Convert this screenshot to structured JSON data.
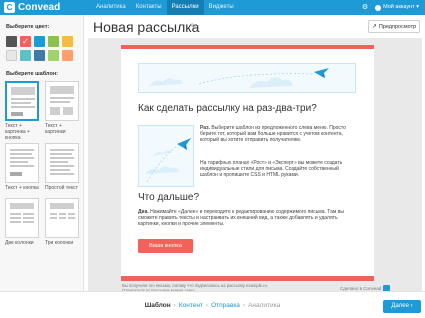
{
  "header": {
    "logo_mark": "C",
    "logo_text": "Convead",
    "nav": [
      {
        "label": "Аналитика"
      },
      {
        "label": "Контакты"
      },
      {
        "label": "Рассылки"
      },
      {
        "label": "Виджеты"
      }
    ],
    "nav_active_index": 2,
    "account_label": "Мой аккаунт ▾",
    "gear": "⚙"
  },
  "sidebar": {
    "color_title": "Выберите цвет:",
    "colors": [
      "#555555",
      "#f2625a",
      "#1e9ad6",
      "#8cc152",
      "#f6bb42",
      "#e8e8e8",
      "#5dc1c9",
      "#3f7ba8",
      "#a0d468",
      "#ff9f6b"
    ],
    "selected_color_index": 1,
    "template_title": "Выберите шаблон:",
    "templates": [
      {
        "label": "Текст + картинка + кнопка"
      },
      {
        "label": "Текст + картинки"
      },
      {
        "label": "Текст + кнопка"
      },
      {
        "label": "Простой текст"
      },
      {
        "label": "Две колонки"
      },
      {
        "label": "Три колонки"
      }
    ],
    "selected_template_index": 0
  },
  "main": {
    "title": "Новая рассылка",
    "pencil": "✎",
    "preview_label": "Предпросмотр",
    "preview_icon": "↗"
  },
  "email": {
    "heading": "Как сделать рассылку на раз-два-три?",
    "para1_bold": "Раз.",
    "para1": " Выберите шаблон из предложенного слева меню. Просто берите тот, который вам больше нравится с учетом контента, который вы хотите отправить получателям.",
    "para2": "На тарифных планах «Рост» и «Эксперт» вы можете создать индивидуальные стили для письма. Создайте собственный шаблон и пропишите CSS и HTML руками.",
    "subheading": "Что дальше?",
    "para3_bold": "Два.",
    "para3": " Нажимайте «Далее» и переходите к редактированию содержимого письма. Там вы сможете править тексты и настраивать их внешний вид, а также добавлять и удалять картинки, кнопки и прочие элементы.",
    "button_label": "Ваша кнопка",
    "footer_line1": "Вы получили это письмо, потому что подписались на рассылку example.ru.",
    "footer_line2": "Отписаться от рассылки можно здесь.",
    "footer_brand": "Сделано в Convead"
  },
  "steps": {
    "items": [
      {
        "label": "Шаблон",
        "state": "current"
      },
      {
        "label": "Контент",
        "state": "next"
      },
      {
        "label": "Отправка",
        "state": "next"
      },
      {
        "label": "Аналитика",
        "state": "future"
      }
    ],
    "separator": "›"
  },
  "next_button": "Далее ›",
  "colors": {
    "brand": "#1e9ad6",
    "accent": "#f2625a"
  }
}
